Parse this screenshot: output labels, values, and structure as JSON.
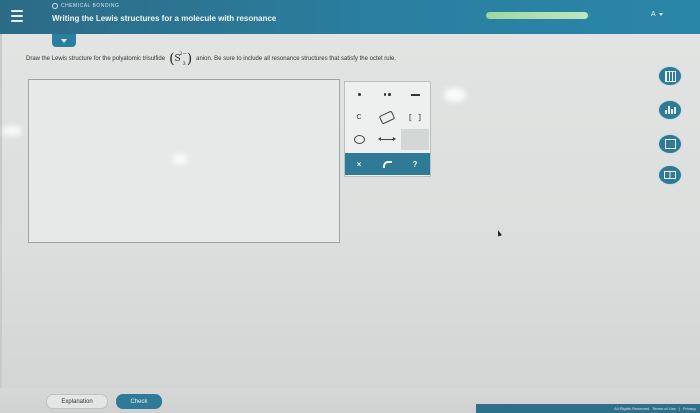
{
  "header": {
    "section": "CHEMICAL BONDING",
    "title": "Writing the Lewis structures for a molecule with resonance",
    "progress_fraction": 0.98,
    "user_initial": "A",
    "menu_icon": "hamburger-icon"
  },
  "prompt": {
    "before": "Draw the Lewis structure for the polyatomic trisulfide",
    "symbol": "S",
    "superscript": "2−",
    "subscript": "3",
    "after": "anion. Be sure to include all resonance structures that satisfy the octet rule."
  },
  "palette": {
    "row1": [
      "single-dot",
      "double-dot",
      "single-bond"
    ],
    "row2": {
      "element": "C",
      "eraser": "eraser-icon",
      "bracket": "[ ]"
    },
    "row3": [
      "lasso-icon",
      "resonance-arrow-icon"
    ],
    "bar": {
      "clear": "×",
      "undo": "undo-icon",
      "help": "?"
    }
  },
  "tools": [
    "calculator-icon",
    "chart-bars-icon",
    "periodic-table-icon",
    "reference-icon"
  ],
  "buttons": {
    "explanation": "Explanation",
    "check": "Check"
  },
  "footer": {
    "rights": "All Rights Reserved",
    "terms": "Terms of Use",
    "privacy": "Privacy"
  },
  "colors": {
    "header": "#2a7fa0",
    "accent": "#2e7a97",
    "progress": "#bfe6bf"
  }
}
